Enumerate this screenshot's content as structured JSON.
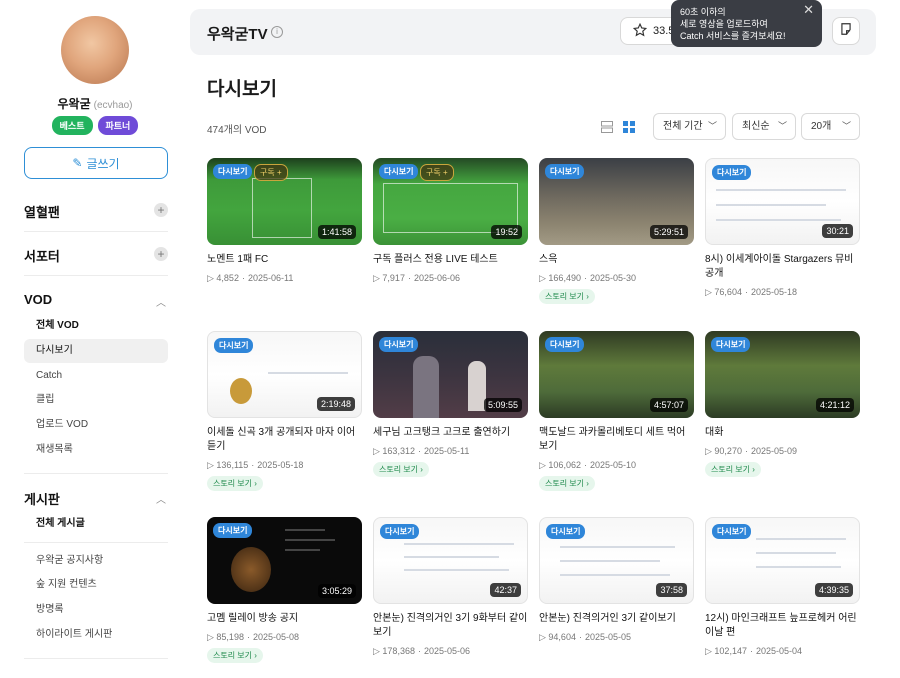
{
  "sidebar": {
    "profile": {
      "name": "우왁굳",
      "id": "(ecvhao)"
    },
    "badges": [
      "베스트",
      "파트너"
    ],
    "write_button": "글쓰기",
    "sections": {
      "fan": "열혈팬",
      "supporter": "서포터",
      "vod": "VOD",
      "board": "게시판"
    },
    "vod_items": [
      "전체 VOD",
      "다시보기",
      "Catch",
      "클립",
      "업로드 VOD",
      "재생목록"
    ],
    "board_items": [
      "전체 게시글",
      "우왁굳 공지사항",
      "숲 지원 컨텐츠",
      "방명록",
      "하이라이트 게시판"
    ]
  },
  "header": {
    "channel_name": "우왁굳TV",
    "favorite_count": "33.5",
    "tooltip": [
      "60초 이하의",
      "세로 영상을 업로드하여",
      "Catch 서비스를 즐겨보세요!"
    ]
  },
  "main": {
    "title": "다시보기",
    "count": "474개의 VOD",
    "filters": {
      "period": "전체 기간",
      "sort": "최신순",
      "per_page": "20개"
    },
    "replay_tag": "다시보기",
    "sub_tag": "구독 +",
    "story_label": "스토리 보기"
  },
  "videos": [
    {
      "title": "노멘트 1패 FC",
      "views": "4,852",
      "date": "2025-06-11",
      "duration": "1:41:58",
      "sub": true,
      "story": false
    },
    {
      "title": "구독 플러스 전용 LIVE 테스트",
      "views": "7,917",
      "date": "2025-06-06",
      "duration": "19:52",
      "sub": true,
      "story": false
    },
    {
      "title": "스윽",
      "views": "166,490",
      "date": "2025-05-30",
      "duration": "5:29:51",
      "sub": false,
      "story": true
    },
    {
      "title": "8시) 이세계아이돌 Stargazers 뮤비 공개",
      "views": "76,604",
      "date": "2025-05-18",
      "duration": "30:21",
      "sub": false,
      "story": false
    },
    {
      "title": "이세돌 신곡 3개 공개되자 마자 이어듣기",
      "views": "136,115",
      "date": "2025-05-18",
      "duration": "2:19:48",
      "sub": false,
      "story": true
    },
    {
      "title": "세구님 고크탱크 고크로 출연하기",
      "views": "163,312",
      "date": "2025-05-11",
      "duration": "5:09:55",
      "sub": false,
      "story": true
    },
    {
      "title": "맥도날드 과카몰리베토디 세트 먹어보기",
      "views": "106,062",
      "date": "2025-05-10",
      "duration": "4:57:07",
      "sub": false,
      "story": true
    },
    {
      "title": "대화",
      "views": "90,270",
      "date": "2025-05-09",
      "duration": "4:21:12",
      "sub": false,
      "story": true
    },
    {
      "title": "고멤 릴레이 방송 공지",
      "views": "85,198",
      "date": "2025-05-08",
      "duration": "3:05:29",
      "sub": false,
      "story": true
    },
    {
      "title": "안본눈) 진격의거인 3기 9화부터 같이보기",
      "views": "178,368",
      "date": "2025-05-06",
      "duration": "42:37",
      "sub": false,
      "story": false
    },
    {
      "title": "안본눈) 진격의거인 3기 같이보기",
      "views": "94,604",
      "date": "2025-05-05",
      "duration": "37:58",
      "sub": false,
      "story": false
    },
    {
      "title": "12시) 마인크래프트 늪프로헤커 어린이날 편",
      "views": "102,147",
      "date": "2025-05-04",
      "duration": "4:39:35",
      "sub": false,
      "story": false
    }
  ],
  "colors": {
    "accent": "#2f86d9",
    "best_badge": "#22b35e",
    "partner_badge": "#6f4bd8"
  }
}
